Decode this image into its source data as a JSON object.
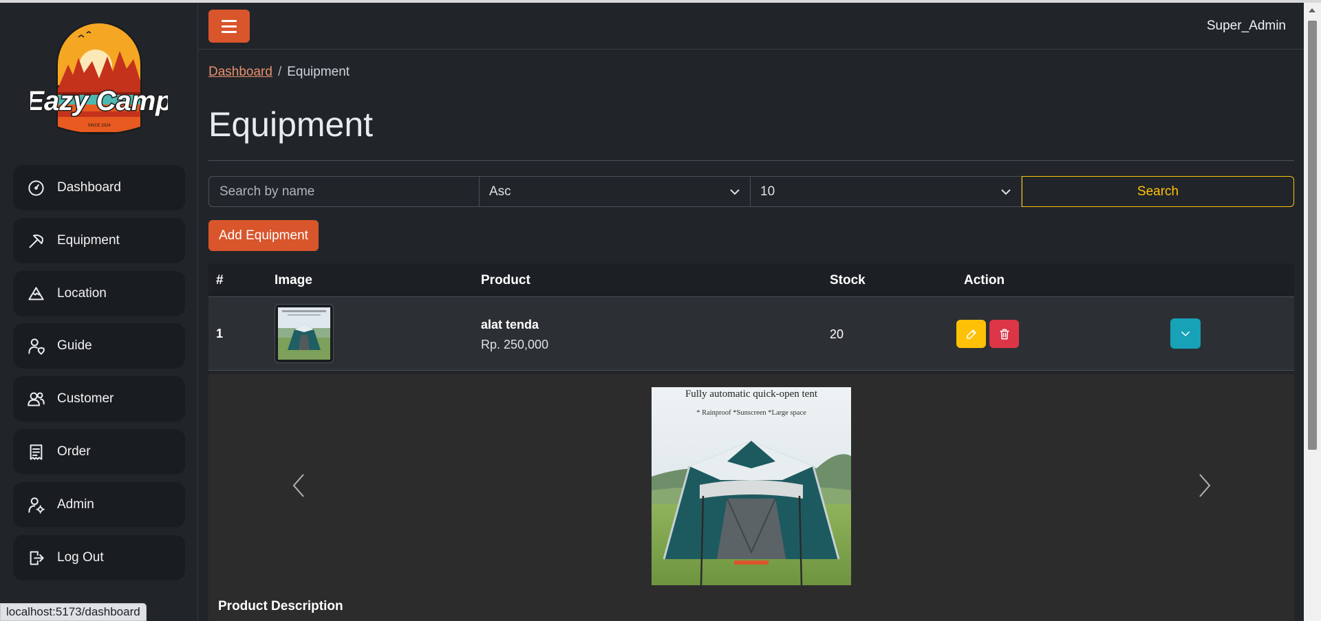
{
  "app": {
    "user": "Super_Admin",
    "status_url": "localhost:5173/dashboard"
  },
  "logo": {
    "line1": "Eazy Camp",
    "line2": "SINCE 2024"
  },
  "sidebar": {
    "items": [
      {
        "label": "Dashboard",
        "icon": "speedometer-icon"
      },
      {
        "label": "Equipment",
        "icon": "pickaxe-icon"
      },
      {
        "label": "Location",
        "icon": "mountain-icon"
      },
      {
        "label": "Guide",
        "icon": "person-shield-icon"
      },
      {
        "label": "Customer",
        "icon": "people-icon"
      },
      {
        "label": "Order",
        "icon": "receipt-icon"
      },
      {
        "label": "Admin",
        "icon": "person-gear-icon"
      },
      {
        "label": "Log Out",
        "icon": "box-arrow-right-icon"
      }
    ]
  },
  "breadcrumb": {
    "link": "Dashboard",
    "separator": "/",
    "current": "Equipment"
  },
  "page": {
    "title": "Equipment"
  },
  "filters": {
    "search_placeholder": "Search by name",
    "sort_value": "Asc",
    "limit_value": "10",
    "search_label": "Search"
  },
  "actions": {
    "add_label": "Add Equipment"
  },
  "table": {
    "headers": [
      "#",
      "Image",
      "Product",
      "Stock",
      "Action"
    ],
    "rows": [
      {
        "index": "1",
        "name": "alat tenda",
        "price": "Rp. 250,000",
        "stock": "20"
      }
    ]
  },
  "expanded": {
    "image_caption": "Fully automatic quick-open tent",
    "image_subcaption": "* Rainproof  *Sunscreen  *Large space",
    "description_title": "Product Description"
  },
  "colors": {
    "accent": "#d9552b",
    "warning": "#ffc107",
    "danger": "#dc3545",
    "info": "#17a2b8",
    "background": "#212529"
  }
}
